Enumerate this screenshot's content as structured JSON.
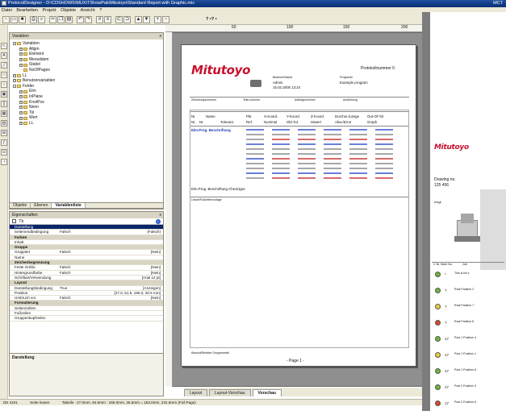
{
  "window": {
    "title": "ProtocolDesigner - D:\\CDSHOWS\\MUX\\TShowPak\\Mitutoyo\\Standard Report with Graphic.mic",
    "right_title": "MCT"
  },
  "menu": [
    "Datei",
    "Bearbeiten",
    "Projekt",
    "Objekte",
    "Ansicht",
    "?"
  ],
  "toolbar": {
    "help_label": "? •? •"
  },
  "variables_panel": {
    "title": "Variablen",
    "close": "x",
    "tree": [
      {
        "level": 0,
        "label": "Variablen",
        "expander": "-"
      },
      {
        "level": 1,
        "label": "Allgm",
        "expander": "+"
      },
      {
        "level": 1,
        "label": "Element",
        "expander": "+"
      },
      {
        "level": 1,
        "label": "Messdaten",
        "expander": "+"
      },
      {
        "level": 1,
        "label": "Statist",
        "expander": "+"
      },
      {
        "level": 1,
        "label": "NoOfPages",
        "expander": ""
      },
      {
        "level": 0,
        "label": "LL",
        "expander": "+"
      },
      {
        "level": 0,
        "label": "Benutzervariablen",
        "expander": "+"
      },
      {
        "level": 0,
        "label": "Felder",
        "expander": "-"
      },
      {
        "level": 1,
        "label": "Elm",
        "expander": "+"
      },
      {
        "level": 1,
        "label": "InPlane",
        "expander": "+"
      },
      {
        "level": 1,
        "label": "KnotPos",
        "expander": "+"
      },
      {
        "level": 1,
        "label": "Nenn",
        "expander": "+"
      },
      {
        "level": 1,
        "label": "Tol",
        "expander": "+"
      },
      {
        "level": 1,
        "label": "Wert",
        "expander": "+"
      },
      {
        "level": 1,
        "label": "LL",
        "expander": "+"
      }
    ]
  },
  "panel_tabs": [
    "Objekte",
    "Ebenen",
    "Variablenliste"
  ],
  "properties_panel": {
    "title": "Eigenschaften",
    "close": "x",
    "object": "Tb",
    "rows": [
      {
        "kind": "sel",
        "name": "Darstellung",
        "type": "",
        "value": ""
      },
      {
        "kind": "row",
        "name": "Seitenendbedingung",
        "type": "Falsch",
        "value": "(Falsch)"
      },
      {
        "kind": "cat",
        "name": "Farben",
        "type": "",
        "value": ""
      },
      {
        "kind": "row",
        "name": "Inhalt",
        "type": "",
        "value": ""
      },
      {
        "kind": "cat",
        "name": "Gruppe",
        "type": "",
        "value": ""
      },
      {
        "kind": "row",
        "name": "Gruppiert",
        "type": "Falsch",
        "value": "[Nein]"
      },
      {
        "kind": "row",
        "name": "Name",
        "type": "",
        "value": ""
      },
      {
        "kind": "cat",
        "name": "Zeichenbegrenzung",
        "type": "",
        "value": ""
      },
      {
        "kind": "row",
        "name": "Feste Größe",
        "type": "Falsch",
        "value": "[Nein]"
      },
      {
        "kind": "row",
        "name": "Hintergrundfarbe",
        "type": "Falsch",
        "value": "[Nein]"
      },
      {
        "kind": "row",
        "name": "Schriftart/Verwendung",
        "type": "",
        "value": "[Arial 12 pt]"
      },
      {
        "kind": "cat",
        "name": "Layout",
        "type": "",
        "value": ""
      },
      {
        "kind": "row",
        "name": "Darstellungsbedingung",
        "type": "True",
        "value": "[Anzeigen]"
      },
      {
        "kind": "row",
        "name": "Position",
        "type": "",
        "value": "[27.0, 51.5, 156.0, 20.5 mm]"
      },
      {
        "kind": "row",
        "name": "Umbruch vor",
        "type": "Falsch",
        "value": "[Nein]"
      },
      {
        "kind": "cat",
        "name": "Formatierung",
        "type": "",
        "value": ""
      },
      {
        "kind": "row",
        "name": "Seitenzahlen",
        "type": "",
        "value": ""
      },
      {
        "kind": "row",
        "name": "Fußzeilen",
        "type": "",
        "value": ""
      },
      {
        "kind": "row",
        "name": "Gruppenkopfzeilen",
        "type": "",
        "value": ""
      }
    ],
    "footer_title": "Darstellung"
  },
  "ruler": {
    "marks": [
      "50",
      "100",
      "150",
      "200",
      "250"
    ]
  },
  "report": {
    "logo": "Mitutoyo",
    "protocol_label": "Protokollnummer 0",
    "operator_hdr": "Bediener/Name",
    "operator": "Admin",
    "date": "15.02.2005 13:24",
    "program_hdr": "Programm",
    "program": "Example program",
    "info_row": [
      "Zeichnungsnummer",
      "Teile-nummer",
      "Auftragsnummer",
      "Ausführung"
    ],
    "table_headers": [
      "Nr",
      "Name",
      "Pkt",
      "X-Koord.",
      "Y-Koord.",
      "Z-Koord.",
      "Durchm./Länge",
      "Out-Of-Tol"
    ],
    "table_sub": [
      "Nr.",
      "Nr.",
      "Toleranz",
      "Ref.",
      "Nominal",
      "Obl.Tol.",
      "Istwert",
      "Abw./Error",
      "Graph"
    ],
    "section_label": "Elm.Prog. Beschriftung",
    "footer_left": "Elm.Prog. Beschriftung Checktyps",
    "footer_note": "Lesart/Fußzeilenvorlage",
    "bottom_note": "Absolut/Relative Gruppenzeile",
    "page_label": "- Page 1 -"
  },
  "bottom_tabs": [
    "Layout",
    "Layout-Vorschau",
    "Vorschau"
  ],
  "status": {
    "cell": "DE 4101",
    "page": "Seite leuten",
    "zoom": "Tabelle : 27.0mm, 94.5mm : 156.0mm, 25.5mm = 163.0mm, 231.5mm (Fixf.Page)"
  },
  "preview": {
    "logo": "Mitutoyo",
    "drawing_no_label": "Drawing no.",
    "drawing_no": "125 456",
    "part_label": "Insgt",
    "col_headers": [
      "C.Nr. Mam No.",
      "Job"
    ],
    "items": [
      {
        "nr": "*",
        "text": "This is list x",
        "mood": "good"
      },
      {
        "nr": "?",
        "text": "Rost  Position 2",
        "mood": "good"
      },
      {
        "nr": "?",
        "text": "Rost  Position 7",
        "mood": "warn"
      },
      {
        "nr": "?",
        "text": "Rost  Position 8",
        "mood": "bad"
      },
      {
        "nr": "17",
        "text": "Post 1  Position 4",
        "mood": "good"
      },
      {
        "nr": "17",
        "text": "Post 1  Position 1",
        "mood": "warn"
      },
      {
        "nr": "17",
        "text": "Post 1  Position 6",
        "mood": "good"
      },
      {
        "nr": "17",
        "text": "Post 2  Position 3",
        "mood": "good"
      },
      {
        "nr": "17",
        "text": "Post 2  Position 6",
        "mood": "bad"
      }
    ]
  },
  "colors": {
    "accent": "#0a246a",
    "logo": "#c8102e",
    "good": "#6bb83a",
    "warn": "#e7d13c",
    "bad": "#d9472b"
  }
}
